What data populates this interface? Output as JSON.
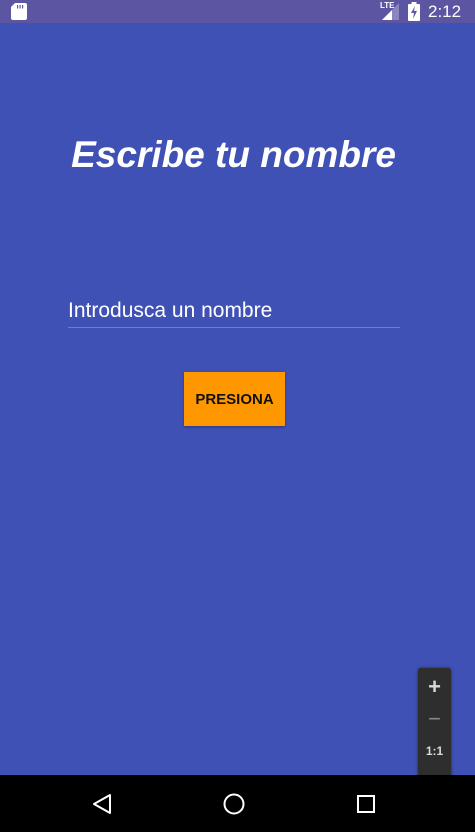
{
  "status_bar": {
    "network": "LTE",
    "time": "2:12",
    "icons": [
      "sd-card-icon",
      "signal-icon",
      "battery-charging-icon"
    ]
  },
  "main": {
    "title": "Escribe tu nombre",
    "name_input": {
      "placeholder": "Introdusca un nombre",
      "value": ""
    },
    "submit_label": "PRESIONA"
  },
  "zoom_controls": {
    "zoom_in": "+",
    "zoom_out": "−",
    "reset": "1:1",
    "icons": [
      "zoom-in-icon",
      "zoom-out-icon",
      "fit-screen-icon"
    ]
  },
  "navigation_bar": {
    "icons": [
      "back-icon",
      "home-icon",
      "recents-icon"
    ]
  },
  "colors": {
    "background": "#3F51B5",
    "status_bar": "#5C55A2",
    "accent_button": "#FF9800",
    "nav_bar": "#000000"
  }
}
